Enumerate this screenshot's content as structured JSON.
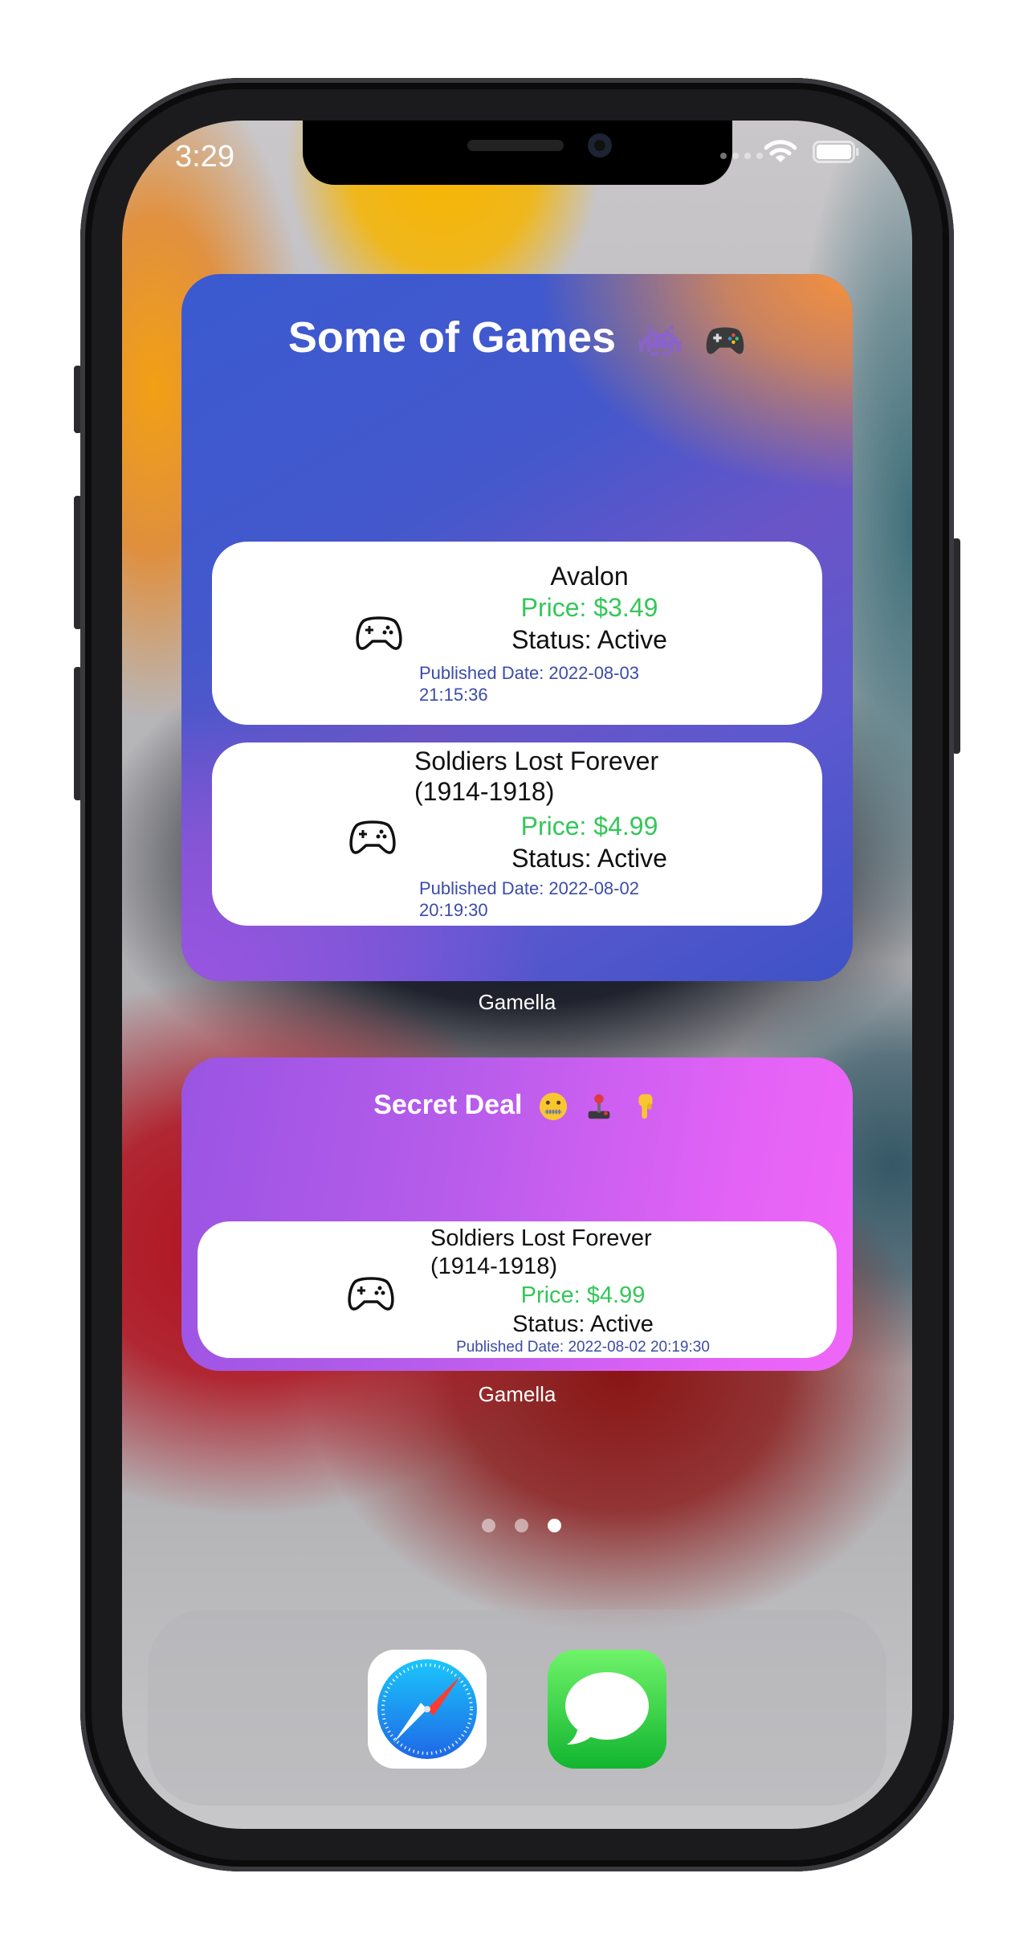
{
  "status_bar": {
    "time": "3:29"
  },
  "widget_top": {
    "title": "Some of Games",
    "games": [
      {
        "name": "Avalon",
        "price": "Price: $3.49",
        "status": "Status: Active",
        "published_line1": "Published Date: 2022-08-03",
        "published_line2": "21:15:36"
      },
      {
        "name_line1": "Soldiers Lost Forever",
        "name_line2": "(1914-1918)",
        "price": "Price: $4.99",
        "status": "Status: Active",
        "published_line1": "Published Date: 2022-08-02",
        "published_line2": "20:19:30"
      }
    ],
    "app_label": "Gamella"
  },
  "widget_bottom": {
    "title": "Secret Deal",
    "game": {
      "name_line1": "Soldiers Lost Forever",
      "name_line2": "(1914-1918)",
      "price": "Price: $4.99",
      "status": "Status: Active",
      "published": "Published Date: 2022-08-02 20:19:30"
    },
    "app_label": "Gamella"
  },
  "page_indicator": {
    "pages": 3,
    "current": 3
  },
  "dock": {
    "apps": [
      "safari-icon",
      "messages-icon"
    ]
  },
  "colors": {
    "price_green": "#34c759",
    "published_blue": "#3b4ca8",
    "widget_top_gradient": [
      "#3b5ad0",
      "#f5913d",
      "#9a55e0"
    ],
    "widget_bottom_gradient": [
      "#9a54e2",
      "#ef66f8"
    ]
  }
}
